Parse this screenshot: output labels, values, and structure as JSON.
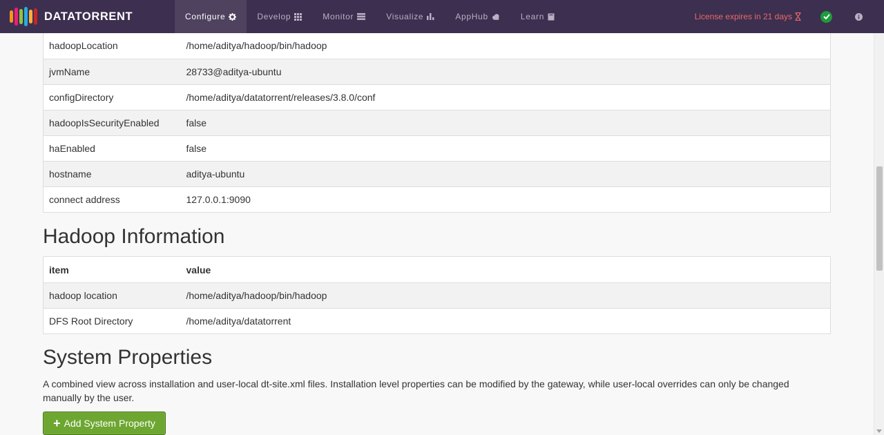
{
  "brand": {
    "name": "DATATORRENT",
    "logo_colors": [
      "#f7941d",
      "#ed1e79",
      "#8dc63f",
      "#29abe2",
      "#fbb03b",
      "#c1272d"
    ]
  },
  "nav": [
    {
      "label": "Configure",
      "icon": "gear-icon",
      "active": true
    },
    {
      "label": "Develop",
      "icon": "grid-icon",
      "active": false
    },
    {
      "label": "Monitor",
      "icon": "server-icon",
      "active": false
    },
    {
      "label": "Visualize",
      "icon": "bar-chart-icon",
      "active": false
    },
    {
      "label": "AppHub",
      "icon": "cloud-icon",
      "active": false
    },
    {
      "label": "Learn",
      "icon": "book-icon",
      "active": false
    }
  ],
  "header_right": {
    "license_text": "License expires in 21 days",
    "license_icon": "hourglass-icon",
    "status_icon": "check-circle-icon",
    "info_icon": "info-icon"
  },
  "gateway_table": [
    {
      "key": "hadoopLocation",
      "value": "/home/aditya/hadoop/bin/hadoop"
    },
    {
      "key": "jvmName",
      "value": "28733@aditya-ubuntu"
    },
    {
      "key": "configDirectory",
      "value": "/home/aditya/datatorrent/releases/3.8.0/conf"
    },
    {
      "key": "hadoopIsSecurityEnabled",
      "value": "false"
    },
    {
      "key": "haEnabled",
      "value": "false"
    },
    {
      "key": "hostname",
      "value": "aditya-ubuntu"
    },
    {
      "key": "connect address",
      "value": "127.0.0.1:9090"
    }
  ],
  "hadoop_info": {
    "title": "Hadoop Information",
    "headers": {
      "item": "item",
      "value": "value"
    },
    "rows": [
      {
        "key": "hadoop location",
        "value": "/home/aditya/hadoop/bin/hadoop"
      },
      {
        "key": "DFS Root Directory",
        "value": "/home/aditya/datatorrent"
      }
    ]
  },
  "system_properties": {
    "title": "System Properties",
    "description": "A combined view across installation and user-local dt-site.xml files. Installation level properties can be modified by the gateway, while user-local overrides can only be changed manually by the user.",
    "add_button_label": "Add System Property"
  }
}
